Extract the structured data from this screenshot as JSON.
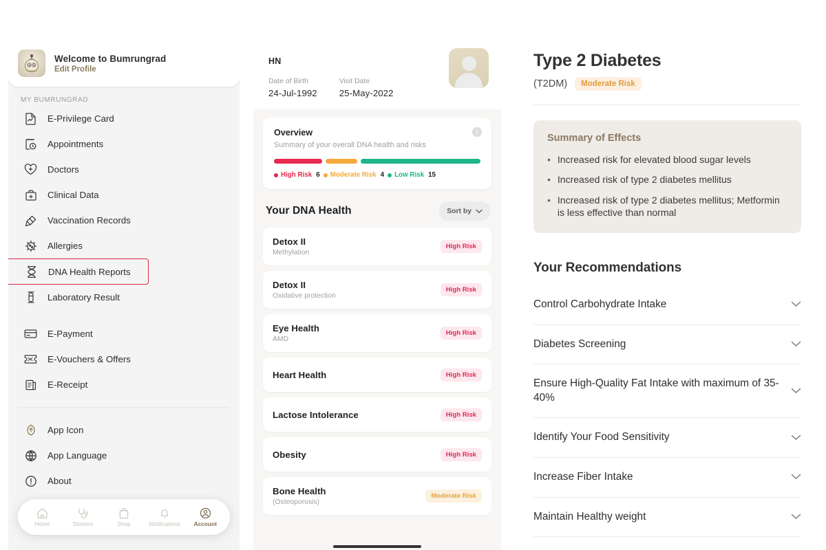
{
  "sidebar": {
    "profile": {
      "welcome": "Welcome to Bumrungrad",
      "edit_profile": "Edit Profile",
      "logo_icon": "bumrungrad-mascot-icon"
    },
    "section_label": "MY BUMRUNGRAD",
    "items": [
      {
        "label": "E-Privilege Card",
        "icon": "card-document-icon",
        "highlighted": false
      },
      {
        "label": "Appointments",
        "icon": "calendar-clock-icon",
        "highlighted": false
      },
      {
        "label": "Doctors",
        "icon": "heart-plus-icon",
        "highlighted": false
      },
      {
        "label": "Clinical Data",
        "icon": "medical-bag-icon",
        "highlighted": false
      },
      {
        "label": "Vaccination Records",
        "icon": "syringe-icon",
        "highlighted": false
      },
      {
        "label": "Allergies",
        "icon": "allergen-cell-icon",
        "highlighted": false
      },
      {
        "label": "DNA Health Reports",
        "icon": "dna-helix-icon",
        "highlighted": true
      },
      {
        "label": "Laboratory Result",
        "icon": "test-tube-icon",
        "highlighted": false
      }
    ],
    "items_secondary": [
      {
        "label": "E-Payment",
        "icon": "credit-card-icon"
      },
      {
        "label": "E-Vouchers & Offers",
        "icon": "ticket-icon"
      },
      {
        "label": "E-Receipt",
        "icon": "receipt-icon"
      }
    ],
    "items_tertiary": [
      {
        "label": "App Icon",
        "icon": "app-badge-icon"
      },
      {
        "label": "App Language",
        "icon": "globe-icon"
      },
      {
        "label": "About",
        "icon": "info-circle-icon"
      }
    ],
    "tabbar": [
      {
        "label": "Home",
        "icon": "home-icon",
        "active": false
      },
      {
        "label": "Doctors",
        "icon": "stethoscope-icon",
        "active": false
      },
      {
        "label": "Shop",
        "icon": "shopping-bag-icon",
        "active": false
      },
      {
        "label": "Notifications",
        "icon": "bell-icon",
        "active": false
      },
      {
        "label": "Account",
        "icon": "user-circle-icon",
        "active": true
      }
    ]
  },
  "report": {
    "patient_code": "HN",
    "dob_label": "Date of Birth",
    "dob_value": "24-Jul-1992",
    "visit_label": "Visit Date",
    "visit_value": "25-May-2022",
    "avatar_icon": "user-avatar-placeholder-icon",
    "overview": {
      "title": "Overview",
      "subtitle": "Summary of your overall DNA health and risks",
      "info_icon": "info-icon",
      "legend": [
        {
          "name": "High Risk",
          "count": "6",
          "color": "#e8284e",
          "pct": 24
        },
        {
          "name": "Moderate Risk",
          "count": "4",
          "color": "#f5a93b",
          "pct": 16
        },
        {
          "name": "Low Risk",
          "count": "15",
          "color": "#1cb589",
          "pct": 60
        }
      ]
    },
    "list_title": "Your DNA Health",
    "sort_label": "Sort by",
    "sort_icon": "chevron-down-icon",
    "items": [
      {
        "name": "Detox II",
        "sub": "Methylation",
        "risk": "High Risk",
        "level": "high"
      },
      {
        "name": "Detox II",
        "sub": "Oxidative protection",
        "risk": "High Risk",
        "level": "high"
      },
      {
        "name": "Eye Health",
        "sub": "AMD",
        "risk": "High Risk",
        "level": "high"
      },
      {
        "name": "Heart Health",
        "sub": "",
        "risk": "High Risk",
        "level": "high"
      },
      {
        "name": "Lactose Intolerance",
        "sub": "",
        "risk": "High Risk",
        "level": "high"
      },
      {
        "name": "Obesity",
        "sub": "",
        "risk": "High Risk",
        "level": "high"
      },
      {
        "name": "Bone Health",
        "sub": "(Osteoporosis)",
        "risk": "Moderate Risk",
        "level": "moderate"
      }
    ]
  },
  "detail": {
    "title": "Type 2 Diabetes",
    "abbr": "(T2DM)",
    "risk_badge": "Moderate Risk",
    "summary": {
      "title": "Summary of Effects",
      "bullets": [
        "Increased risk for elevated blood sugar levels",
        "Increased risk of type 2 diabetes mellitus",
        "Increased risk of type 2 diabetes mellitus; Metformin is less effective than normal"
      ]
    },
    "recommendations_title": "Your Recommendations",
    "recommendations": [
      {
        "label": "Control Carbohydrate Intake",
        "icon": "chevron-down-icon"
      },
      {
        "label": "Diabetes Screening",
        "icon": "chevron-down-icon"
      },
      {
        "label": "Ensure High-Quality Fat Intake with maximum of 35-40%",
        "icon": "chevron-down-icon"
      },
      {
        "label": "Identify Your Food Sensitivity",
        "icon": "chevron-down-icon"
      },
      {
        "label": "Increase Fiber Intake",
        "icon": "chevron-down-icon"
      },
      {
        "label": "Maintain Healthy weight",
        "icon": "chevron-down-icon"
      }
    ]
  },
  "colors": {
    "high_risk": "#e8284e",
    "moderate_risk": "#f5a93b",
    "low_risk": "#1cb589",
    "accent_brown": "#8b7a63",
    "highlight_border": "#d8293f"
  }
}
